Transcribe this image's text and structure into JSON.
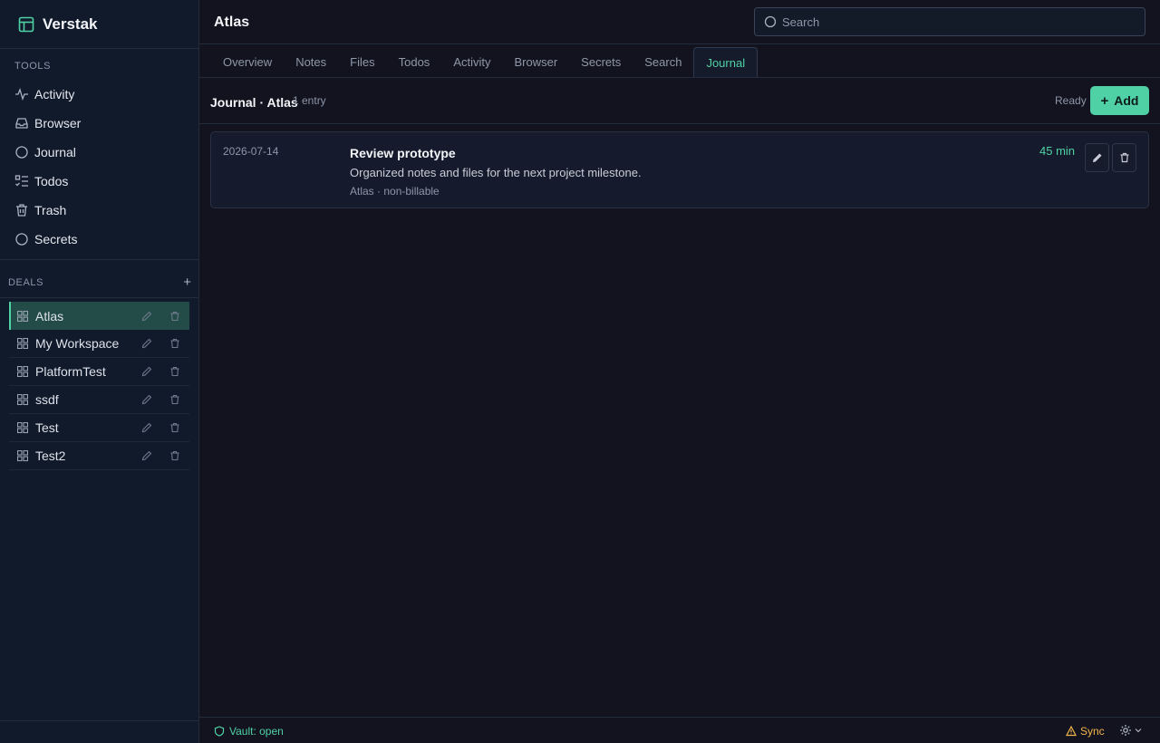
{
  "app": {
    "name": "Verstak"
  },
  "sidebar": {
    "tools_title": "TOOLS",
    "tools": [
      {
        "label": "Activity",
        "icon": "activity-icon"
      },
      {
        "label": "Browser",
        "icon": "inbox-icon"
      },
      {
        "label": "Journal",
        "icon": "circle-icon"
      },
      {
        "label": "Todos",
        "icon": "list-todo-icon"
      },
      {
        "label": "Trash",
        "icon": "trash-icon"
      },
      {
        "label": "Secrets",
        "icon": "circle-icon"
      }
    ],
    "deals_title": "DEALS",
    "deals_add": "+",
    "deals": [
      {
        "label": "Atlas"
      },
      {
        "label": "My Workspace"
      },
      {
        "label": "PlatformTest"
      },
      {
        "label": "ssdf"
      },
      {
        "label": "Test"
      },
      {
        "label": "Test2"
      }
    ]
  },
  "header": {
    "title": "Atlas",
    "search_placeholder": "Search"
  },
  "tabs": [
    "Overview",
    "Notes",
    "Files",
    "Todos",
    "Activity",
    "Browser",
    "Secrets",
    "Search",
    "Journal"
  ],
  "active_tab": "Journal",
  "toolbar": {
    "title": "Journal · Atlas",
    "count": "1 entry",
    "status": "Ready",
    "add_label": "Add",
    "add_plus": "+"
  },
  "entries": [
    {
      "date": "2026-07-14",
      "title": "Review prototype",
      "description": "Organized notes and files for the next project milestone.",
      "meta": "Atlas · non-billable",
      "duration": "45 min"
    }
  ],
  "statusbar": {
    "vault": "Vault: open",
    "sync": "Sync"
  },
  "colors": {
    "accent": "#4fd1a5",
    "warning": "#f0b54a",
    "background": "#13131f",
    "sidebar": "#111a2b"
  }
}
